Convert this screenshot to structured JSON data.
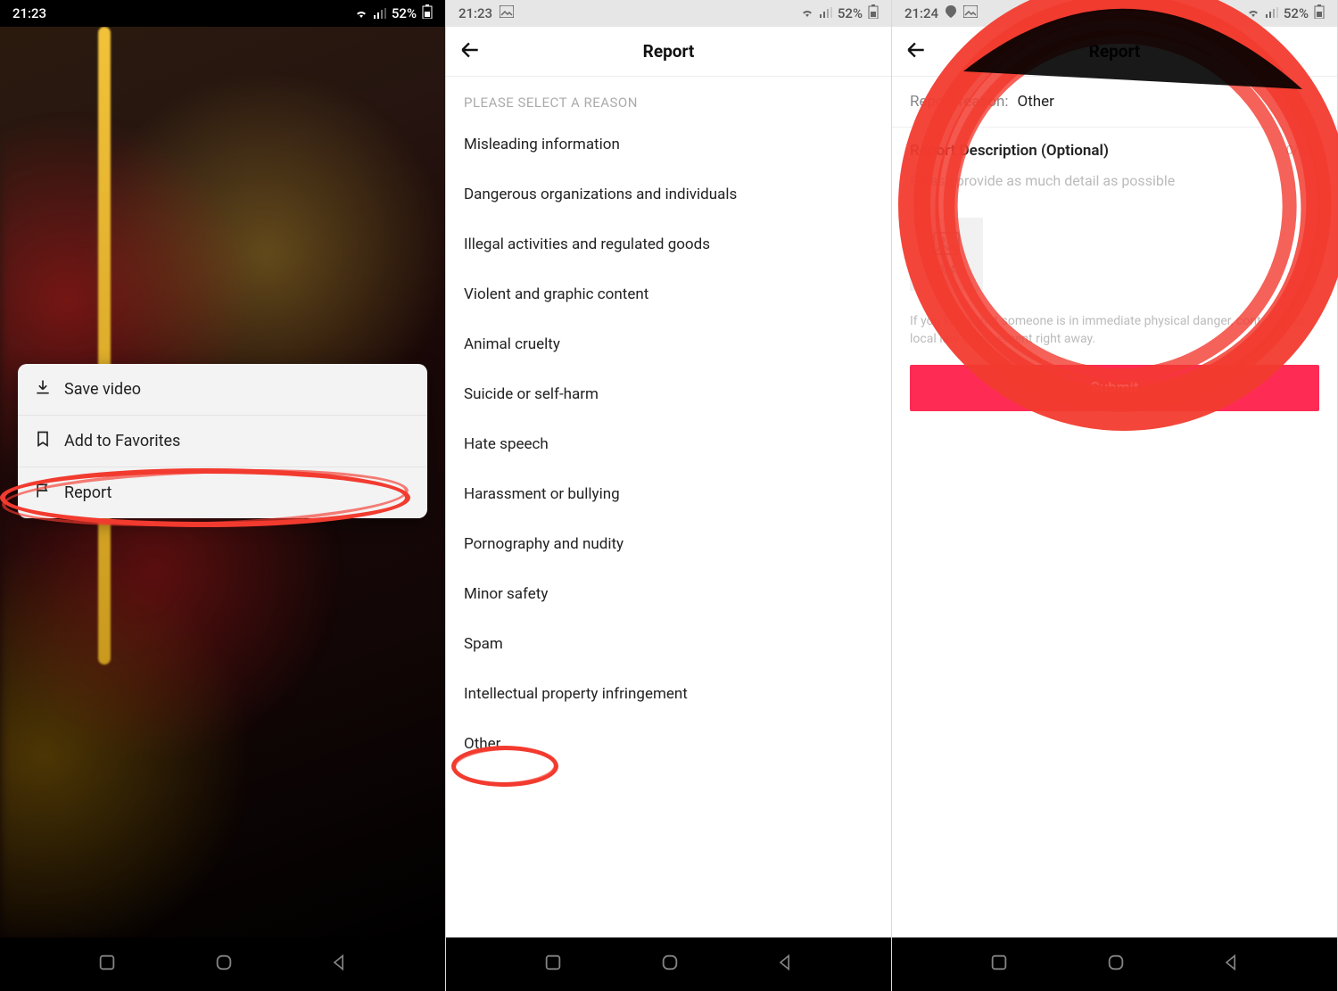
{
  "screen1": {
    "status": {
      "time": "21:23",
      "battery": "52%"
    },
    "sheet": {
      "save": "Save video",
      "favorite": "Add to Favorites",
      "report": "Report"
    }
  },
  "screen2": {
    "status": {
      "time": "21:23",
      "battery": "52%"
    },
    "title": "Report",
    "section_label": "PLEASE SELECT A REASON",
    "reasons": [
      "Misleading information",
      "Dangerous organizations and individuals",
      "Illegal activities and regulated goods",
      "Violent and graphic content",
      "Animal cruelty",
      "Suicide or self-harm",
      "Hate speech",
      "Harassment or bullying",
      "Pornography and nudity",
      "Minor safety",
      "Spam",
      "Intellectual property infringement",
      "Other"
    ]
  },
  "screen3": {
    "status": {
      "time": "21:24",
      "battery": "52%"
    },
    "title": "Report",
    "reason_label": "Report reason:",
    "reason_value": "Other",
    "desc_title": "Report Description (Optional)",
    "desc_count": "0/200",
    "desc_placeholder": "Please provide as much detail as possible",
    "upload_count": "0/4",
    "notice": "If you know that someone is in immediate physical danger, contact your local law enforcement right away.",
    "submit": "Submit"
  },
  "colors": {
    "accent": "#fe2c55",
    "annotation": "#f23b2f"
  }
}
